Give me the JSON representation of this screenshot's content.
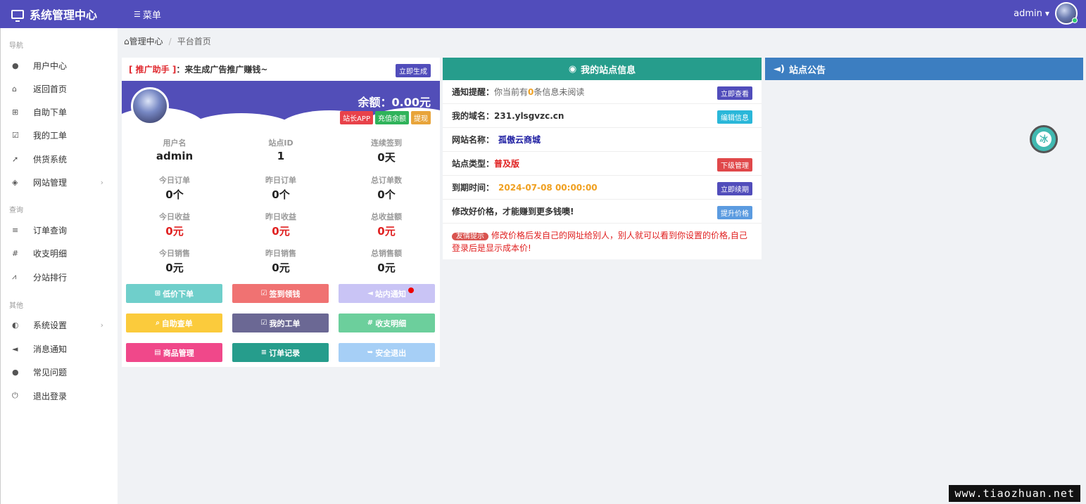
{
  "header": {
    "title": "系统管理中心",
    "menu_label": "菜单",
    "user": "admin"
  },
  "sidebar": {
    "sections": [
      {
        "label": "导航",
        "items": [
          {
            "label": "用户中心",
            "icon": "user-icon"
          },
          {
            "label": "返回首页",
            "icon": "home-icon"
          },
          {
            "label": "自助下单",
            "icon": "cart-icon"
          },
          {
            "label": "我的工单",
            "icon": "check-square-icon"
          },
          {
            "label": "供货系统",
            "icon": "rocket-icon"
          },
          {
            "label": "网站管理",
            "icon": "cube-icon",
            "expandable": true
          }
        ]
      },
      {
        "label": "查询",
        "items": [
          {
            "label": "订单查询",
            "icon": "list-icon"
          },
          {
            "label": "收支明细",
            "icon": "hashtag-icon"
          },
          {
            "label": "分站排行",
            "icon": "line-chart-icon"
          }
        ]
      },
      {
        "label": "其他",
        "items": [
          {
            "label": "系统设置",
            "icon": "settings-icon",
            "expandable": true
          },
          {
            "label": "消息通知",
            "icon": "bullhorn-icon"
          },
          {
            "label": "常见问题",
            "icon": "exclamation-circle-icon"
          },
          {
            "label": "退出登录",
            "icon": "power-icon"
          }
        ]
      }
    ]
  },
  "breadcrumb": {
    "home": "管理中心",
    "current": "平台首页"
  },
  "promo": {
    "tag": "[ 推广助手 ]",
    "colon": "：",
    "text": "来生成广告推广赚钱~",
    "button": "立即生成"
  },
  "profile": {
    "balance": "余额：0.00元",
    "tags": [
      "站长APP",
      "充值余额",
      "提现"
    ],
    "stats": [
      {
        "label": "用户名",
        "value": "admin"
      },
      {
        "label": "站点ID",
        "value": "1"
      },
      {
        "label": "连续签到",
        "value": "0天"
      },
      {
        "label": "今日订单",
        "value": "0个"
      },
      {
        "label": "昨日订单",
        "value": "0个"
      },
      {
        "label": "总订单数",
        "value": "0个"
      },
      {
        "label": "今日收益",
        "value": "0元"
      },
      {
        "label": "昨日收益",
        "value": "0元"
      },
      {
        "label": "总收益额",
        "value": "0元"
      },
      {
        "label": "今日销售",
        "value": "0元"
      },
      {
        "label": "昨日销售",
        "value": "0元"
      },
      {
        "label": "总销售额",
        "value": "0元"
      }
    ],
    "buttons": [
      {
        "label": "低价下单",
        "icon": "cart-icon",
        "color": "#6fcfcb"
      },
      {
        "label": "签到领钱",
        "icon": "check-icon",
        "color": "#f07272"
      },
      {
        "label": "站内通知",
        "icon": "bullhorn-icon",
        "color": "#c9c4f5"
      },
      {
        "label": "自助查单",
        "icon": "search-icon",
        "color": "#fbcb3c"
      },
      {
        "label": "我的工单",
        "icon": "check-square-icon",
        "color": "#6b6894"
      },
      {
        "label": "收支明细",
        "icon": "hashtag-icon",
        "color": "#6ccf9c"
      },
      {
        "label": "商品管理",
        "icon": "table-icon",
        "color": "#f0488a"
      },
      {
        "label": "订单记录",
        "icon": "list-icon",
        "color": "#269d8c"
      },
      {
        "label": "安全退出",
        "icon": "sign-out-icon",
        "color": "#a6cff6"
      }
    ]
  },
  "site_info": {
    "title": "我的站点信息",
    "notice_label": "通知提醒：",
    "notice_pre": "你当前有",
    "notice_count": "0",
    "notice_post": "条信息未阅读",
    "notice_btn": "立即查看",
    "domain_label": "我的域名：",
    "domain": "231.ylsgvzc.cn",
    "domain_btn": "编辑信息",
    "name_label": "网站名称：",
    "name": "孤傲云商城",
    "type_label": "站点类型：",
    "type": "普及版",
    "type_btn": "下级管理",
    "expire_label": "到期时间：",
    "expire": "2024-07-08 00:00:00",
    "expire_btn": "立即续期",
    "price_text": "修改好价格，才能赚到更多钱噢!",
    "price_btn": "提升价格",
    "tip_pill": "友情提示",
    "tip_text": "修改价格后发自己的网址给别人，别人就可以看到你设置的价格,自己登录后是显示成本价!"
  },
  "notice": {
    "title": "站点公告"
  },
  "watermark": "www.tiaozhuan.net",
  "colors": {
    "primary": "#514dbb",
    "teal": "#269d8c",
    "blue": "#3c7ec1"
  }
}
